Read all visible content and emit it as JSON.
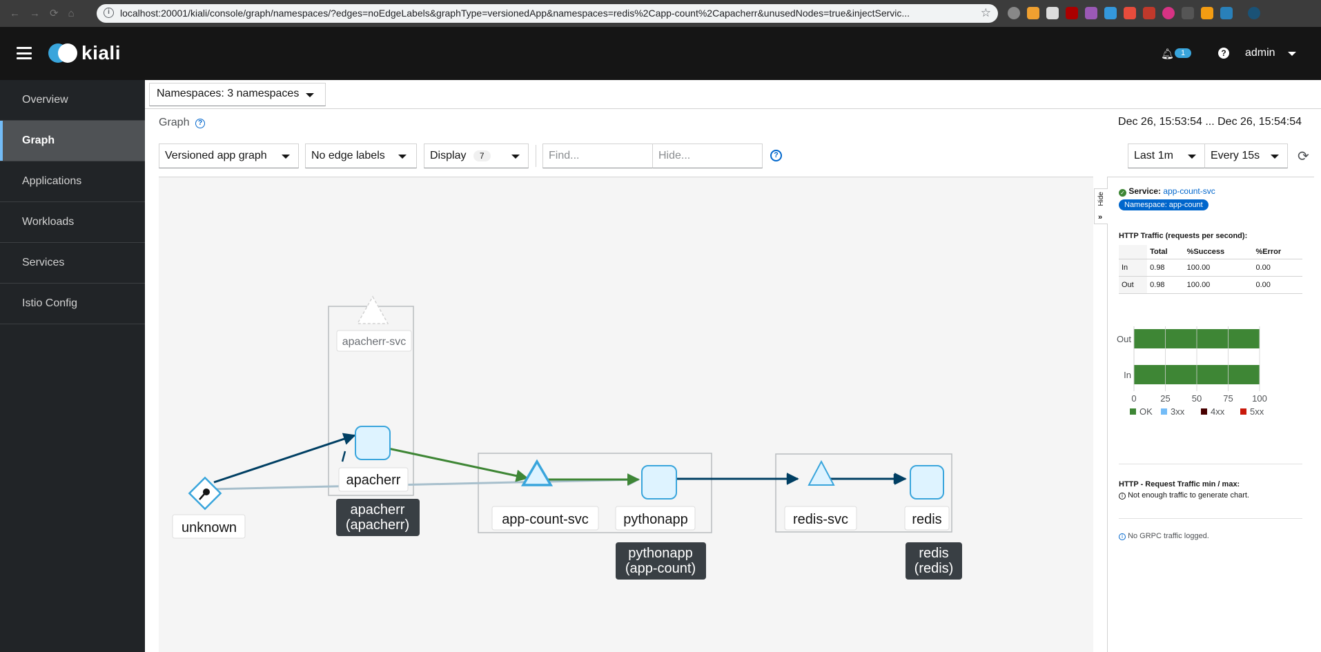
{
  "browser": {
    "url": "localhost:20001/kiali/console/graph/namespaces/?edges=noEdgeLabels&graphType=versionedApp&namespaces=redis%2Capp-count%2Capacherr&unusedNodes=true&injectServic..."
  },
  "masthead": {
    "logo_text": "kiali",
    "notification_count": "1",
    "user": "admin"
  },
  "sidebar": {
    "items": [
      {
        "label": "Overview",
        "active": false
      },
      {
        "label": "Graph",
        "active": true
      },
      {
        "label": "Applications",
        "active": false
      },
      {
        "label": "Workloads",
        "active": false
      },
      {
        "label": "Services",
        "active": false
      },
      {
        "label": "Istio Config",
        "active": false
      }
    ]
  },
  "namespace_selector": {
    "label": "Namespaces: 3 namespaces"
  },
  "page": {
    "title": "Graph",
    "time_range": "Dec 26, 15:53:54 ... Dec 26, 15:54:54"
  },
  "toolbar": {
    "graph_type": "Versioned app graph",
    "edge_labels": "No edge labels",
    "display_label": "Display",
    "display_count": "7",
    "find_placeholder": "Find...",
    "hide_placeholder": "Hide...",
    "duration": "Last 1m",
    "refresh_interval": "Every 15s"
  },
  "graph": {
    "nodes": {
      "unknown": "unknown",
      "apacherr_svc": "apacherr-svc",
      "apacherr": "apacherr",
      "app_count_svc": "app-count-svc",
      "pythonapp": "pythonapp",
      "redis_svc": "redis-svc",
      "redis": "redis"
    },
    "boxes": {
      "apacherr_line1": "apacherr",
      "apacherr_line2": "(apacherr)",
      "pythonapp_line1": "pythonapp",
      "pythonapp_line2": "(app-count)",
      "redis_line1": "redis",
      "redis_line2": "(redis)"
    },
    "colors": {
      "healthy_edge": "#3e8635",
      "tcp_edge": "#003f63",
      "idle_edge": "#a7bfcc",
      "node_fill": "#def3ff",
      "node_border": "#39a5dc"
    }
  },
  "side_panel": {
    "hide_label": "Hide",
    "service_prefix": "Service:",
    "service_name": "app-count-svc",
    "namespace_badge": "Namespace: app-count",
    "traffic_title": "HTTP Traffic (requests per second):",
    "table": {
      "headers": [
        "",
        "Total",
        "%Success",
        "%Error"
      ],
      "rows": [
        [
          "In",
          "0.98",
          "100.00",
          "0.00"
        ],
        [
          "Out",
          "0.98",
          "100.00",
          "0.00"
        ]
      ]
    },
    "chart_data": {
      "type": "bar",
      "orientation": "horizontal",
      "stacked": true,
      "categories": [
        "Out",
        "In"
      ],
      "series": [
        {
          "name": "OK",
          "values": [
            100,
            100
          ],
          "color": "#3e8635"
        },
        {
          "name": "3xx",
          "values": [
            0,
            0
          ],
          "color": "#73bcf7"
        },
        {
          "name": "4xx",
          "values": [
            0,
            0
          ],
          "color": "#470000"
        },
        {
          "name": "5xx",
          "values": [
            0,
            0
          ],
          "color": "#c9190b"
        }
      ],
      "xlim": [
        0,
        100
      ],
      "xticks": [
        "0",
        "25",
        "50",
        "75",
        "100"
      ],
      "grid": true,
      "legend": "bottom"
    },
    "request_traffic_title": "HTTP - Request Traffic min / max:",
    "request_traffic_note": "Not enough traffic to generate chart.",
    "grpc_note": "No GRPC traffic logged."
  }
}
